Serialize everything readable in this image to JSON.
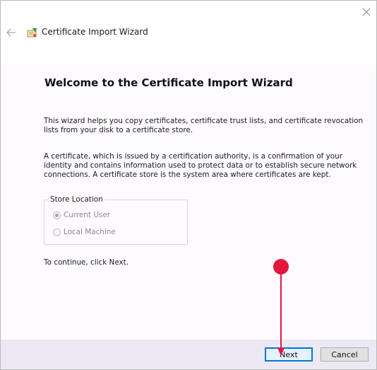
{
  "window": {
    "title": "Certificate Import Wizard"
  },
  "content": {
    "heading": "Welcome to the Certificate Import Wizard",
    "paragraph1": "This wizard helps you copy certificates, certificate trust lists, and certificate revocation lists from your disk to a certificate store.",
    "paragraph2": "A certificate, which is issued by a certification authority, is a confirmation of your identity and contains information used to protect data or to establish secure network connections. A certificate store is the system area where certificates are kept.",
    "store_location": {
      "legend": "Store Location",
      "options": [
        {
          "label": "Current User",
          "selected": true,
          "enabled": false
        },
        {
          "label": "Local Machine",
          "selected": false,
          "enabled": false
        }
      ]
    },
    "continue_text": "To continue, click Next."
  },
  "footer": {
    "next_label": "Next",
    "cancel_label": "Cancel"
  },
  "icons": {
    "close": "close-icon",
    "back": "back-arrow-icon",
    "wizard": "certificate-icon"
  },
  "colors": {
    "accent": "#0078d7",
    "annotation": "#e5163c",
    "footer_bg": "#ece9f4",
    "content_bg": "#fdfbff"
  }
}
